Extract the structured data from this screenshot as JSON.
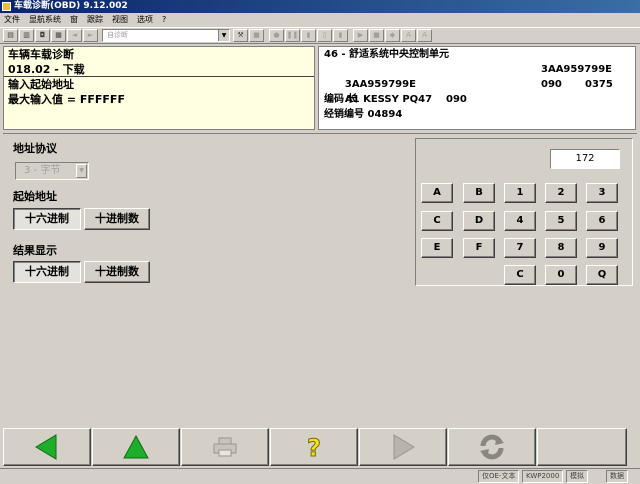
{
  "window": {
    "title": "车载诊断(OBD) 9.12.002"
  },
  "menu": [
    "文件",
    "显航系统",
    "窗",
    "跟踪",
    "视图",
    "选项",
    "?"
  ],
  "toolbar": {
    "combo_value": "自诊断"
  },
  "info_left": {
    "line1": "车辆车载诊断",
    "line2": "018.02 - 下载",
    "line3": "输入起始地址",
    "line4": "最大输入值 = FFFFFF"
  },
  "info_right": {
    "line1": "46 - 舒适系统中央控制单元",
    "line2a": "3AA959799E",
    "line2b": "3AA959799E",
    "line3a": "A1 KESSY PQ47    090",
    "line3b": "090",
    "line3c": "0375",
    "line4": "编码 长",
    "line5": "经销编号 04894"
  },
  "form": {
    "address_protocol_label": "地址协议",
    "address_protocol_value": "3 - 字节",
    "start_address_label": "起始地址",
    "result_label": "结果显示",
    "hex_label": "十六进制",
    "dec_label": "十进制数"
  },
  "keypad": {
    "display": "172",
    "keys": [
      "A",
      "B",
      "1",
      "2",
      "3",
      "C",
      "D",
      "4",
      "5",
      "6",
      "E",
      "F",
      "7",
      "8",
      "9",
      "C",
      "0",
      "Q"
    ]
  },
  "statusbar": {
    "cell1": "仅OE-文本",
    "cell2": "KWP2000",
    "cell3": "模拟",
    "cell4": "数据"
  },
  "colors": {
    "info_left_bg": "#ffffe1",
    "nav_green": "#1fae2a",
    "help_yellow": "#f4e21c",
    "title_blue": "#0a246a"
  }
}
